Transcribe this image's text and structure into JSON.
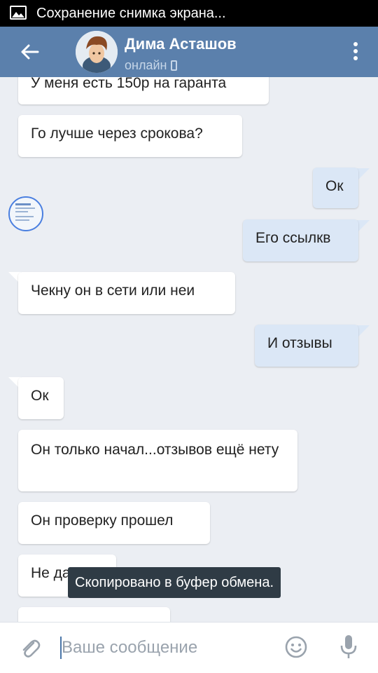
{
  "status_bar": {
    "notification_text": "Сохранение снимка экрана..."
  },
  "header": {
    "name": "Дима Асташов",
    "status": "онлайн"
  },
  "messages": [
    {
      "side": "in",
      "text": "У меня есть 150р на гаранта"
    },
    {
      "side": "in",
      "text": "Го лучше через срокова?"
    },
    {
      "side": "out",
      "text": "Ок"
    },
    {
      "side": "out",
      "text": "Его ссылкв"
    },
    {
      "side": "in",
      "text": "Чекну он в сети или неи"
    },
    {
      "side": "out",
      "text": "И отзывы"
    },
    {
      "side": "in",
      "text": "Ок"
    },
    {
      "side": "in",
      "text": "Он только начал...отзывов ещё нету"
    },
    {
      "side": "in",
      "text": "Он проверку прошел"
    },
    {
      "side": "in",
      "text": "Не да"
    }
  ],
  "toast": "Скопировано в буфер обмена.",
  "composer": {
    "placeholder": "Ваше сообщение",
    "value": ""
  },
  "icons": [
    "image-icon",
    "back-arrow-icon",
    "more-vert-icon",
    "phone-icon",
    "paperclip-icon",
    "smile-icon",
    "mic-icon"
  ],
  "colors": {
    "header": "#5b80ac",
    "background": "#ebeef3",
    "outgoing_bubble": "#dbe7f6",
    "incoming_bubble": "#ffffff",
    "toast": "#2f3b45"
  }
}
